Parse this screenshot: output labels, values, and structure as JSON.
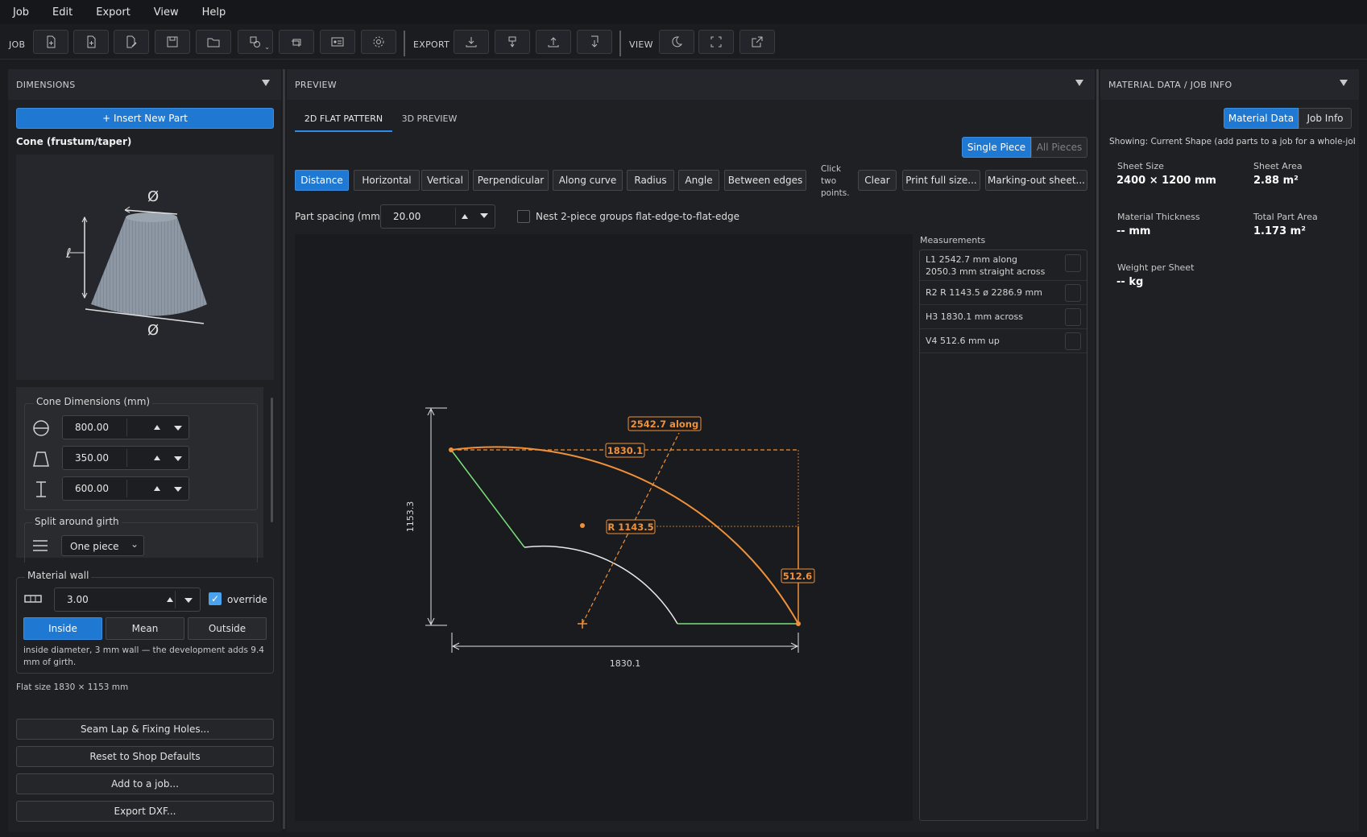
{
  "menu": [
    "Job",
    "Edit",
    "Export",
    "View",
    "Help"
  ],
  "toolbar": {
    "job_label": "JOB",
    "export_label": "EXPORT",
    "view_label": "VIEW"
  },
  "dimensions": {
    "header": "DIMENSIONS",
    "insert_label": "+ Insert New Part",
    "shape_title": "Cone (frustum/taper)",
    "group_title": "Cone Dimensions (mm)",
    "diameter_top": "800.00",
    "diameter_bottom": "350.00",
    "height": "600.00",
    "split_title": "Split around girth",
    "split_value": "One piece",
    "material_title": "Material wall",
    "wall": "3.00",
    "override_label": "override",
    "wall_modes": [
      "Inside",
      "Mean",
      "Outside"
    ],
    "wall_note": "inside diameter, 3 mm wall — the development adds 9.4 mm of girth.",
    "flat_size": "Flat size 1830 × 1153 mm",
    "actions": [
      "Seam Lap & Fixing Holes...",
      "Reset to Shop Defaults",
      "Add to a job...",
      "Export DXF..."
    ]
  },
  "preview": {
    "header": "PREVIEW",
    "tabs": [
      "2D FLAT PATTERN",
      "3D PREVIEW"
    ],
    "piece_modes": [
      "Single Piece",
      "All Pieces"
    ],
    "tools": [
      "Distance",
      "Horizontal",
      "Vertical",
      "Perpendicular",
      "Along curve",
      "Radius",
      "Angle",
      "Between edges"
    ],
    "hint": [
      "Click",
      "two",
      "points."
    ],
    "clear_label": "Clear",
    "print_label": "Print full size...",
    "marking_label": "Marking-out sheet...",
    "spacing_label": "Part spacing (mm):",
    "spacing_value": "20.00",
    "nest_label": "Nest 2-piece groups flat-edge-to-flat-edge",
    "drawing": {
      "arc_label": "2542.7 along",
      "width_label": "1830.1",
      "radius_label": "R 1143.5",
      "v_label": "512.6",
      "height_dim": "1153.3",
      "width_dim": "1830.1"
    },
    "measurements_title": "Measurements",
    "measurements": [
      {
        "line1": "L1  2542.7 mm along",
        "line2": "2050.3 mm straight across"
      },
      {
        "line1": "R2  R 1143.5   ø 2286.9 mm",
        "line2": ""
      },
      {
        "line1": "H3  1830.1 mm across",
        "line2": ""
      },
      {
        "line1": "V4  512.6 mm up",
        "line2": ""
      }
    ]
  },
  "material": {
    "header": "MATERIAL DATA / JOB INFO",
    "tabs": [
      "Material Data",
      "Job Info"
    ],
    "showing": "Showing: Current Shape (add parts to a job for a whole-job to",
    "sheet_size_k": "Sheet Size",
    "sheet_size_v": "2400 × 1200 mm",
    "sheet_area_k": "Sheet Area",
    "sheet_area_v": "2.88 m²",
    "thickness_k": "Material Thickness",
    "thickness_v": "-- mm",
    "part_area_k": "Total Part Area",
    "part_area_v": "1.173 m²",
    "weight_k": "Weight per Sheet",
    "weight_v": "-- kg"
  },
  "colors": {
    "accent": "#1f78d1",
    "orange": "#f0913a",
    "green": "#7be07b"
  }
}
